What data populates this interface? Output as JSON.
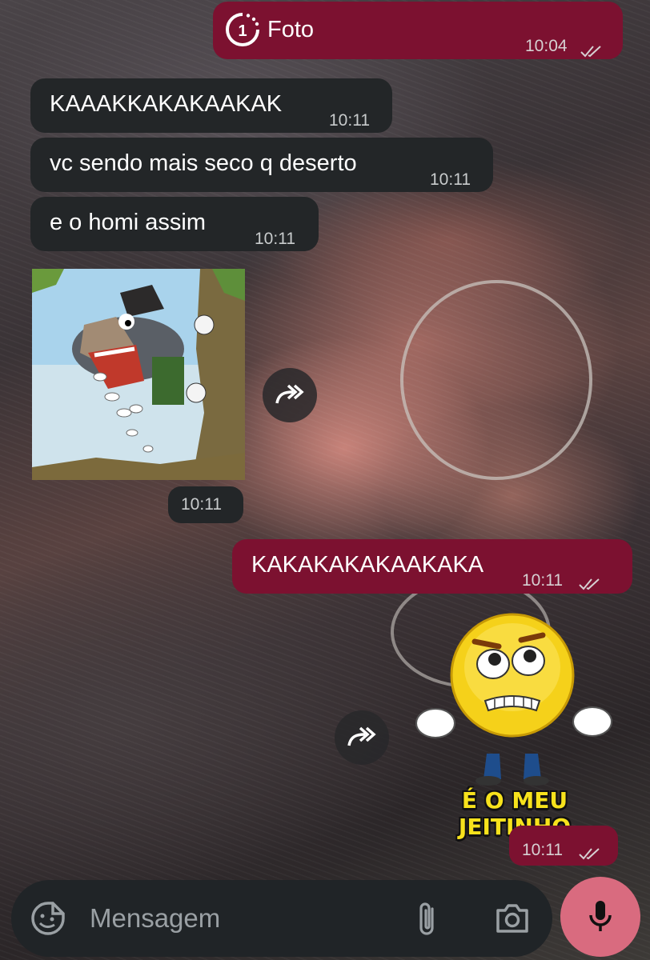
{
  "photo_message": {
    "label": "Foto",
    "time": "10:04",
    "icon": "view-once-icon",
    "read_ticks": "double-check-icon"
  },
  "incoming_messages": [
    {
      "text": "KAAAKKAKAKAAKAK",
      "time": "10:11"
    },
    {
      "text": "vc sendo mais seco q deserto",
      "time": "10:11"
    },
    {
      "text": "e o homi assim",
      "time": "10:11"
    }
  ],
  "incoming_sticker": {
    "time": "10:11",
    "depicts": "cartoon wolf laughing"
  },
  "outgoing_messages": [
    {
      "text": "KAKAKAKAKAAKAKA",
      "time": "10:11"
    }
  ],
  "outgoing_sticker": {
    "caption": "É O MEU JEITINHO",
    "time": "10:11"
  },
  "composer": {
    "placeholder": "Mensagem",
    "emoji_icon": "sticker-smile-icon",
    "attach_icon": "paperclip-icon",
    "camera_icon": "camera-icon",
    "mic_icon": "microphone-icon"
  },
  "colors": {
    "outgoing_bubble": "#7c1130",
    "incoming_bubble": "#232628",
    "mic_button": "#d96b7f",
    "sticker_caption": "#f7e21c"
  }
}
